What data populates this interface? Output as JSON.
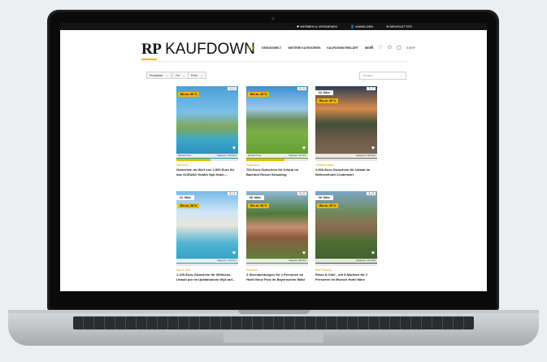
{
  "topbar": {
    "items": [
      "✚ WERBEN & VERDIENEN",
      "👤 ANMELDEN",
      "✉ NEWSLETTER"
    ]
  },
  "logo": {
    "rp": "RP",
    "name": "KAUFDOWN"
  },
  "nav": [
    "SHOP",
    "GENUSSWELT",
    "WEITERE KATEGORIEN",
    "KAUFDOWN ERKLÄRT",
    "NEWS"
  ],
  "header_icons": {
    "cart_total": "0,00 €*"
  },
  "filters": [
    {
      "label": "Produktart"
    },
    {
      "label": "Ort"
    },
    {
      "label": "Preis"
    }
  ],
  "sort": {
    "placeholder": "Sorgen"
  },
  "colors": {
    "accent": "#f2b705",
    "topbar": "#141414"
  },
  "cards": [
    {
      "count": "1 | 1",
      "date": "",
      "badge": "Bis zu -50 %",
      "price_left": "Aktueller Preis",
      "price_right": "Startpreis: 1.500,00 €",
      "progress": 0.55,
      "category": "Wellness",
      "title": "Gutschein im Wert von 1.500 Euro für das OCÉANO Health Spa Hotel,..."
    },
    {
      "count": "0 | 0",
      "date": "",
      "badge": "Bis zu -50 %",
      "price_left": "Aktueller Preis",
      "price_right": "Startpreis: 700,00 €",
      "progress": 0.62,
      "category": "Golfurlaub",
      "title": "700-Euro-Gutschein für Urlaub im Bachhof Resort Straubing"
    },
    {
      "count": "7 | 7",
      "date": "02. März",
      "badge": "Bis zu -50 %",
      "price_left": "",
      "price_right": "Startpreis: 1.000,00 €",
      "progress": 0.0,
      "category": "Genießerhotel",
      "title": "1.000-Euro-Gutschein für Urlaub im Weinseehotel Lindenwirt"
    },
    {
      "count": "3 | 3",
      "date": "02. März",
      "badge": "Bis zu -50 %",
      "price_left": "",
      "price_right": "Startpreis: 1.100,00 €",
      "progress": 0.0,
      "category": "Spa & Golf",
      "title": "1.100-Euro-Gutschein für Wellness-Urlaub pur im Upstalsboom Wyk auf..."
    },
    {
      "count": "9 | 9",
      "date": "06. März",
      "badge": "Bis zu -50 %",
      "price_left": "",
      "price_right": "Startpreis: 858,00 €",
      "progress": 0.0,
      "category": "Wellness",
      "title": "3 Übernachtungen für 2 Personen im Hotel Neue Post im Bayerischen Wald"
    },
    {
      "count": "3 | 3",
      "date": "06. März",
      "badge": "Bis zu -50 %",
      "price_left": "",
      "price_right": "Startpreis: 1.117,00 €",
      "progress": 0.0,
      "category": "Bad Füssing",
      "title": "Relax & Chill - mit 5 Nächten für 2 Personen im Mursch Hotel Mürz"
    }
  ]
}
